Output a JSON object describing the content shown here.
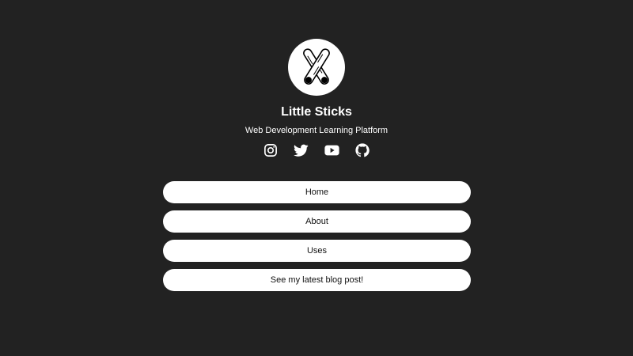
{
  "profile": {
    "name": "Little Sticks",
    "tagline": "Web Development Learning Platform",
    "avatar_icon": "crossed-sticks-logo"
  },
  "socials": [
    {
      "icon": "instagram-icon"
    },
    {
      "icon": "twitter-icon"
    },
    {
      "icon": "youtube-icon"
    },
    {
      "icon": "github-icon"
    }
  ],
  "links": [
    {
      "label": "Home"
    },
    {
      "label": "About"
    },
    {
      "label": "Uses"
    },
    {
      "label": "See my latest blog post!"
    }
  ],
  "colors": {
    "background": "#222222",
    "button_background": "#ffffff",
    "button_text": "#111111",
    "text": "#ffffff"
  }
}
